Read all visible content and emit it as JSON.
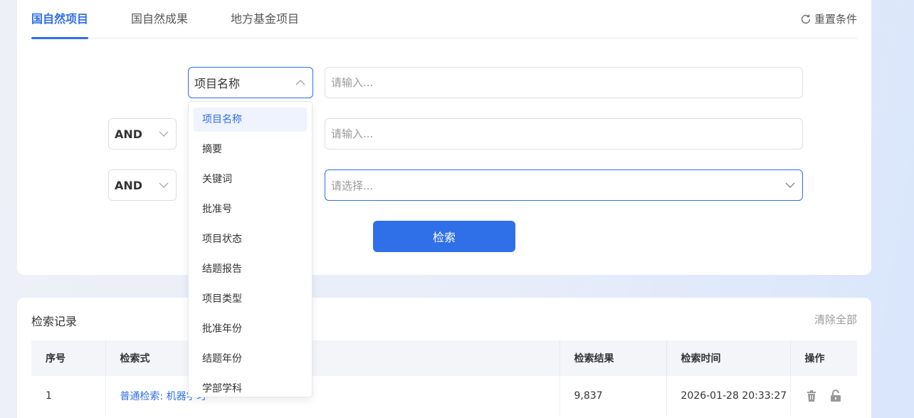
{
  "tabs": [
    {
      "label": "国自然项目"
    },
    {
      "label": "国自然成果"
    },
    {
      "label": "地方基金项目"
    }
  ],
  "reset_label": "重置条件",
  "form": {
    "field_select_value": "项目名称",
    "row1_placeholder": "请输入...",
    "row2_op": "AND",
    "row2_placeholder": "请输入...",
    "row3_op": "AND",
    "row3_placeholder": "请选择...",
    "search_label": "检索"
  },
  "dropdown": {
    "items": [
      "项目名称",
      "摘要",
      "关键词",
      "批准号",
      "项目状态",
      "结题报告",
      "项目类型",
      "批准年份",
      "结题年份",
      "学部学科"
    ],
    "selected": "项目名称"
  },
  "history": {
    "title": "检索记录",
    "clear_label": "清除全部",
    "columns": [
      "序号",
      "检索式",
      "检索结果",
      "检索时间",
      "操作"
    ],
    "rows": [
      {
        "index": "1",
        "query": "普通检索: 机器学习",
        "results": "9,837",
        "time": "2026-01-28 20:33:27"
      }
    ]
  },
  "colors": {
    "accent": "#2f6fe8"
  }
}
